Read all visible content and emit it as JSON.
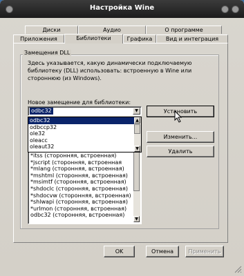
{
  "window": {
    "title": "Настройка Wine"
  },
  "tabs_row1": [
    "Диски",
    "Аудио",
    "О программе"
  ],
  "tabs_row2": [
    "Приложения",
    "Библиотеки",
    "Графика",
    "Вид и интеграция"
  ],
  "active_tab": "Библиотеки",
  "group": {
    "title": "Замещения DLL",
    "description": [
      "Здесь указывается, какую динамически подключаемую",
      "библиотеку (DLL) использовать: встроенную в Wine или",
      "стороннюю (из Windows)."
    ],
    "new_override_label": "Новое замещение для библиотеки:"
  },
  "combo": {
    "value": "odbc32",
    "options": [
      "odbc32",
      "odbccp32",
      "ole32",
      "oleacc",
      "oleaut32"
    ]
  },
  "buttons": {
    "set": "Установить",
    "edit": "Изменить...",
    "delete": "Удалить",
    "ok": "OK",
    "cancel": "Отмена",
    "apply": "Применить"
  },
  "overrides_list": [
    "*itss (сторонняя, встроенная)",
    "*jscript (сторонняя, встроенная",
    "*mlang (сторонняя, встроенная)",
    "*mshtml (сторонняя, встроенная)",
    "*msimtf (сторонняя, встроенная)",
    "*shdoclc (сторонняя, встроенная)",
    "*shdocvw (сторонняя, встроенная)",
    "*shlwapi (сторонняя, встроенная)",
    "*urlmon (сторонняя, встроенная)",
    "odbc32 (сторонняя, встроенная)"
  ],
  "colors": {
    "selection": "#0a246a",
    "titlebar": "#1c1c1c",
    "desktop": "#3a6ea5"
  }
}
